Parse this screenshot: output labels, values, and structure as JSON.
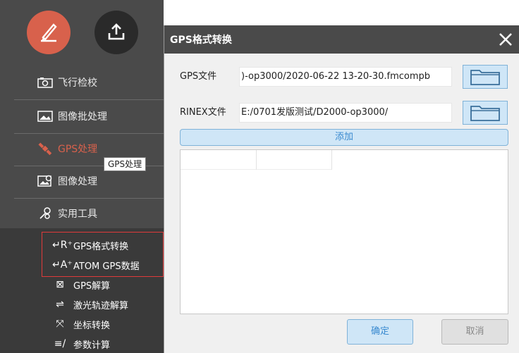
{
  "sidebar": {
    "nav": [
      {
        "label": "飞行检校",
        "icon": "camera-icon"
      },
      {
        "label": "图像批处理",
        "icon": "image-batch-icon"
      },
      {
        "label": "GPS处理",
        "icon": "satellite-icon"
      },
      {
        "label": "图像处理",
        "icon": "image-process-icon"
      },
      {
        "label": "实用工具",
        "icon": "tools-icon"
      }
    ],
    "tooltip": "GPS处理",
    "submenu": [
      {
        "label": "GPS格式转换",
        "glyph": "↵R⁺",
        "icon": "format-convert-icon"
      },
      {
        "label": "ATOM GPS数据",
        "glyph": "↵A⁺",
        "icon": "atom-convert-icon"
      },
      {
        "label": "GPS解算",
        "glyph": "⊠",
        "icon": "gps-solve-icon"
      },
      {
        "label": "激光轨迹解算",
        "glyph": "⇌",
        "icon": "laser-trajectory-icon"
      },
      {
        "label": "坐标转换",
        "glyph": "⤧",
        "icon": "coordinate-icon"
      },
      {
        "label": "参数计算",
        "glyph": "≡/",
        "icon": "parameter-icon"
      }
    ]
  },
  "dialog": {
    "title": "GPS格式转换",
    "gps_label": "GPS文件",
    "gps_value": ")-op3000/2020-06-22 13-20-30.fmcompb",
    "rinex_label": "RINEX文件",
    "rinex_value": "E:/0701发版测试/D2000-op3000/",
    "add_label": "添加",
    "ok_label": "确定",
    "cancel_label": "取消"
  },
  "colors": {
    "accent": "#d8614c",
    "sidebar": "#4a4a4a",
    "button_blue": "#cfe6f7",
    "highlight_red": "#e03a3a"
  }
}
